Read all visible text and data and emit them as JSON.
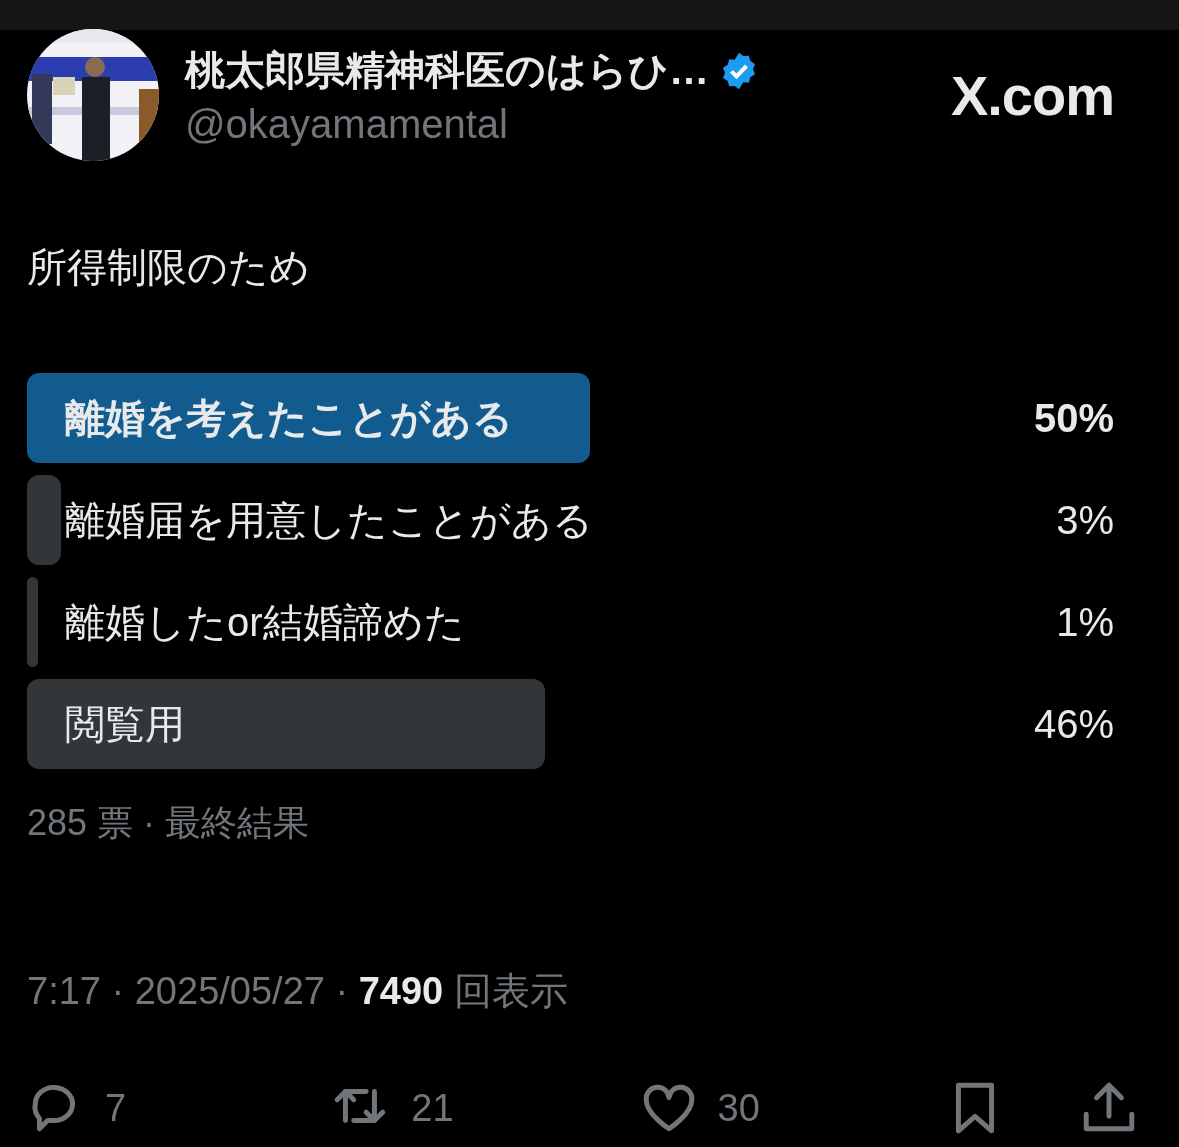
{
  "author": {
    "name": "桃太郎県精神科医のはらひ…",
    "verified": true,
    "handle": "@okayamamental"
  },
  "site": "X.com",
  "text": "所得制限のため",
  "poll": {
    "options": [
      {
        "label": "離婚を考えたことがある",
        "percent": "50%",
        "selected": true
      },
      {
        "label": "離婚届を用意したことがある",
        "percent": "3%",
        "selected": false
      },
      {
        "label": "離婚したor結婚諦めた",
        "percent": "1%",
        "selected": false
      },
      {
        "label": "閲覧用",
        "percent": "46%",
        "selected": false
      }
    ],
    "summary": "285 票 · 最終結果"
  },
  "meta": "7:17 · 2025/05/27 · **7490** 回表示",
  "actions": [
    {
      "kind": "reply",
      "count": "7"
    },
    {
      "kind": "repost",
      "count": "21"
    },
    {
      "kind": "like",
      "count": "30"
    },
    {
      "kind": "bookmark"
    },
    {
      "kind": "share"
    }
  ]
}
